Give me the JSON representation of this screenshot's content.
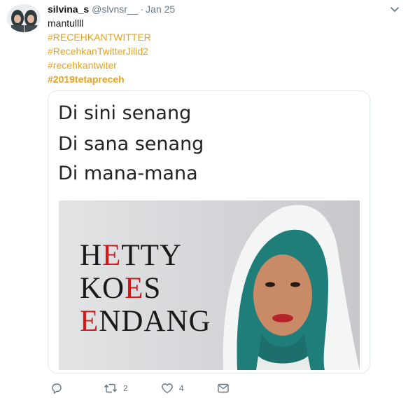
{
  "tweet": {
    "display_name": "silvina_s",
    "handle": "@slvnsr__",
    "separator": "·",
    "date": "Jan 25",
    "text": "mantullll",
    "hashtags": [
      "#RECEHKANTWITTER",
      "#RecehkanTwitterJilid2",
      "#recehkantwiter",
      "#2019tetapreceh"
    ]
  },
  "meme": {
    "lines": [
      "Di sini senang",
      "Di sana senang",
      "Di mana-mana"
    ],
    "name_line1": {
      "before": "H",
      "red": "E",
      "after": "TTY"
    },
    "name_line2": {
      "before": "KO",
      "red": "E",
      "after": "S"
    },
    "name_line3": {
      "before": "",
      "red": "E",
      "after": "NDANG"
    }
  },
  "actions": {
    "reply_icon": "reply-icon",
    "retweet_icon": "retweet-icon",
    "retweet_count": "2",
    "like_icon": "heart-icon",
    "like_count": "4",
    "dm_icon": "envelope-icon"
  },
  "colors": {
    "hashtag": "#e8a317",
    "meta_gray": "#657786",
    "accent_red": "#d01818"
  }
}
